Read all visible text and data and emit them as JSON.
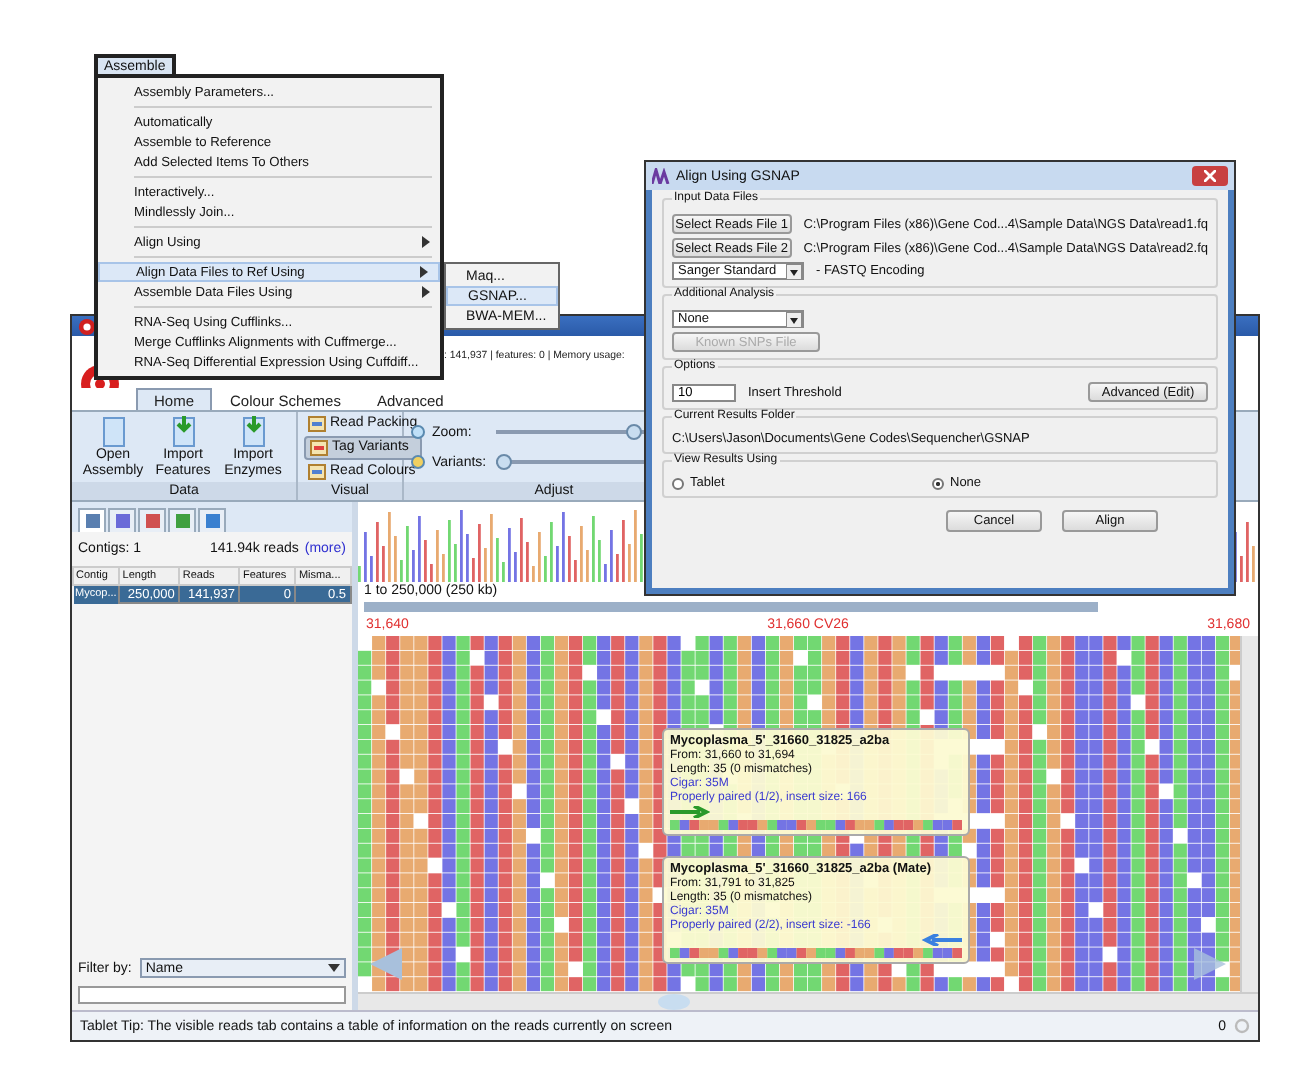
{
  "menu": {
    "title": "Assemble",
    "sections": [
      {
        "items": [
          {
            "label": "Assembly Parameters...",
            "submenu": false,
            "selected": false
          }
        ]
      },
      {
        "items": [
          {
            "label": "Automatically",
            "submenu": false,
            "selected": false
          },
          {
            "label": "Assemble to Reference",
            "submenu": false,
            "selected": false
          },
          {
            "label": "Add Selected Items To Others",
            "submenu": false,
            "selected": false
          }
        ]
      },
      {
        "items": [
          {
            "label": "Interactively...",
            "submenu": false,
            "selected": false
          },
          {
            "label": "Mindlessly Join...",
            "submenu": false,
            "selected": false
          }
        ]
      },
      {
        "items": [
          {
            "label": "Align Using",
            "submenu": true,
            "selected": false
          }
        ]
      },
      {
        "items": [
          {
            "label": "Align Data Files to Ref Using",
            "submenu": true,
            "selected": true
          },
          {
            "label": "Assemble Data Files Using",
            "submenu": true,
            "selected": false
          }
        ]
      },
      {
        "items": [
          {
            "label": "RNA-Seq Using Cufflinks...",
            "submenu": false,
            "selected": false
          },
          {
            "label": "Merge Cufflinks Alignments with Cuffmerge...",
            "submenu": false,
            "selected": false
          },
          {
            "label": "RNA-Seq Differential Expression Using Cuffdiff...",
            "submenu": false,
            "selected": false
          }
        ]
      }
    ]
  },
  "submenu": {
    "items": [
      {
        "label": "Maq...",
        "selected": false
      },
      {
        "label": "GSNAP...",
        "selected": true
      },
      {
        "label": "BWA-MEM...",
        "selected": false
      }
    ]
  },
  "main_window": {
    "summary": ": 141,937  |  features: 0  |  Memory usage:",
    "tabs": [
      {
        "label": "Home",
        "selected": true
      },
      {
        "label": "Colour Schemes",
        "selected": false
      },
      {
        "label": "Advanced",
        "selected": false
      }
    ],
    "groups": [
      {
        "title": "Data",
        "kind": "buttons",
        "items": [
          {
            "label": "Open\nAssembly",
            "selected": false
          },
          {
            "label": "Import\nFeatures",
            "selected": false
          },
          {
            "label": "Import\nEnzymes",
            "selected": false
          }
        ]
      },
      {
        "title": "Visual",
        "kind": "toggles",
        "items": [
          {
            "label": "Read Packing",
            "selected": false
          },
          {
            "label": "Tag Variants",
            "selected": true
          },
          {
            "label": "Read Colours",
            "selected": false
          }
        ]
      },
      {
        "title": "Adjust",
        "kind": "sliders",
        "items": [
          {
            "label": "Zoom:",
            "level": 0.7
          },
          {
            "label": "Variants:",
            "level": 0
          }
        ]
      }
    ],
    "panel_tabs": [
      {
        "selected": true
      },
      {
        "selected": false
      },
      {
        "selected": false
      },
      {
        "selected": false
      },
      {
        "selected": false
      }
    ],
    "contigs": "Contigs: 1",
    "reads": "141.94k reads",
    "more": "(more)",
    "table": {
      "columns": [
        "Contig",
        "Length",
        "Reads",
        "Features",
        "Misma..."
      ],
      "rows": [
        {
          "cells": [
            "Mycop...",
            "250,000",
            "141,937",
            "0",
            "0.5"
          ],
          "selected": true
        }
      ]
    },
    "filter": {
      "label": "Filter by:",
      "value": "Name"
    },
    "range": "1 to 250,000 (250 kb)",
    "ruler": [
      {
        "label": "31,640",
        "color": "#e03030"
      },
      {
        "label": "31,660 CV26",
        "color": "#e03030"
      },
      {
        "label": "31,680",
        "color": "#e03030"
      }
    ],
    "tooltips": [
      {
        "title": "Mycoplasma_5'_31660_31825_a2ba",
        "lines": [
          "From: 31,660 to 31,694",
          "Length: 35 (0 mismatches)"
        ],
        "links": [
          "Cigar: 35M",
          "Properly paired (1/2), insert size: 166"
        ],
        "reverse": false
      },
      {
        "title": "Mycoplasma_5'_31660_31825_a2ba (Mate)",
        "lines": [
          "From: 31,791 to 31,825",
          "Length: 35 (0 mismatches)"
        ],
        "links": [
          "Cigar: 35M",
          "Properly paired (2/2), insert size: -166"
        ],
        "reverse": true
      }
    ],
    "status": "Tablet Tip: The visible reads tab contains a table of information on the reads currently on screen",
    "status_count": "0"
  },
  "dialog": {
    "title": "Align Using GSNAP",
    "input_group": "Input Data Files",
    "files": [
      {
        "button": "Select Reads File 1",
        "path": "C:\\Program Files (x86)\\Gene Cod...4\\Sample Data\\NGS Data\\read1.fq"
      },
      {
        "button": "Select Reads File 2",
        "path": "C:\\Program Files (x86)\\Gene Cod...4\\Sample Data\\NGS Data\\read2.fq"
      }
    ],
    "encoding": {
      "value": "Sanger Standard",
      "label": "- FASTQ Encoding"
    },
    "analysis_group": "Additional Analysis",
    "analysis": "None",
    "snps_button": {
      "label": "Known SNPs File",
      "disabled": true
    },
    "options_group": "Options",
    "threshold": "10",
    "threshold_label": "Insert Threshold",
    "advanced": "Advanced (Edit)",
    "folder_group": "Current Results Folder",
    "folder": "C:\\Users\\Jason\\Documents\\Gene Codes\\Sequencher\\GSNAP",
    "view_group": "View Results Using",
    "view_options": [
      {
        "label": "Tablet",
        "selected": false
      },
      {
        "label": "None",
        "selected": true
      }
    ],
    "buttons": [
      "Cancel",
      "Align"
    ]
  }
}
